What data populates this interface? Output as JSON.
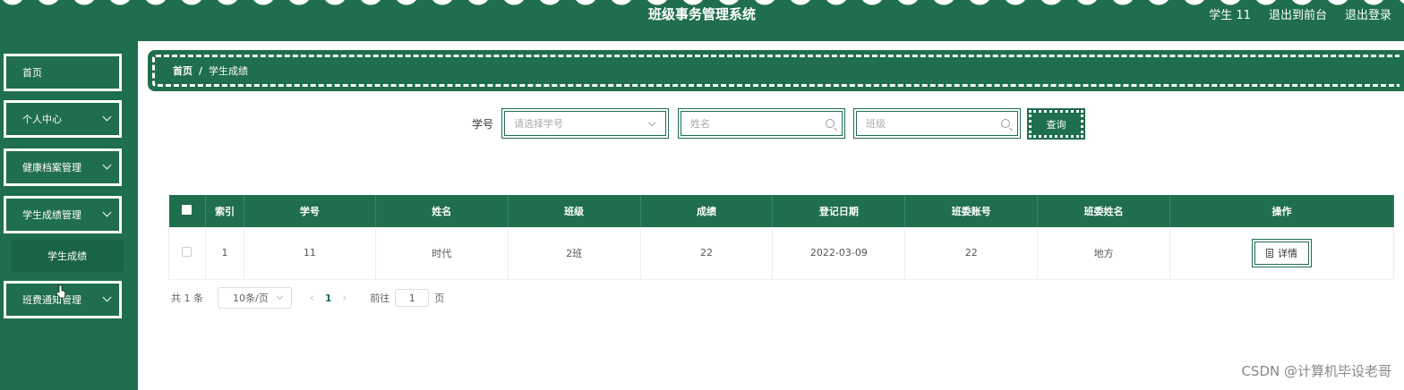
{
  "header": {
    "title": "班级事务管理系统",
    "user": "学生 11",
    "back_to_front": "退出到前台",
    "logout": "退出登录"
  },
  "sidebar": {
    "items": [
      {
        "label": "首页"
      },
      {
        "label": "个人中心"
      },
      {
        "label": "健康档案管理"
      },
      {
        "label": "学生成绩管理"
      },
      {
        "label": "班费通知管理"
      }
    ],
    "submenu_label": "学生成绩"
  },
  "breadcrumb": {
    "home": "首页",
    "separator": "/",
    "current": "学生成绩"
  },
  "search": {
    "student_id_label": "学号",
    "student_id_placeholder": "请选择学号",
    "name_placeholder": "姓名",
    "class_placeholder": "班级",
    "query_button": "查询"
  },
  "table": {
    "columns": [
      "索引",
      "学号",
      "姓名",
      "班级",
      "成绩",
      "登记日期",
      "班委账号",
      "班委姓名",
      "操作"
    ],
    "rows": [
      {
        "index": "1",
        "student_id": "11",
        "name": "时代",
        "class": "2班",
        "score": "22",
        "date": "2022-03-09",
        "monitor_account": "22",
        "monitor_name": "地方",
        "action": "详情"
      }
    ]
  },
  "pagination": {
    "total": "共 1 条",
    "page_size": "10条/页",
    "prev": "‹",
    "current_page": "1",
    "next": "›",
    "goto_label": "前往",
    "goto_value": "1",
    "page_suffix": "页"
  },
  "watermark": "CSDN @计算机毕设老哥",
  "colors": {
    "primary": "#1f6e4e",
    "background": "#ffffff"
  }
}
